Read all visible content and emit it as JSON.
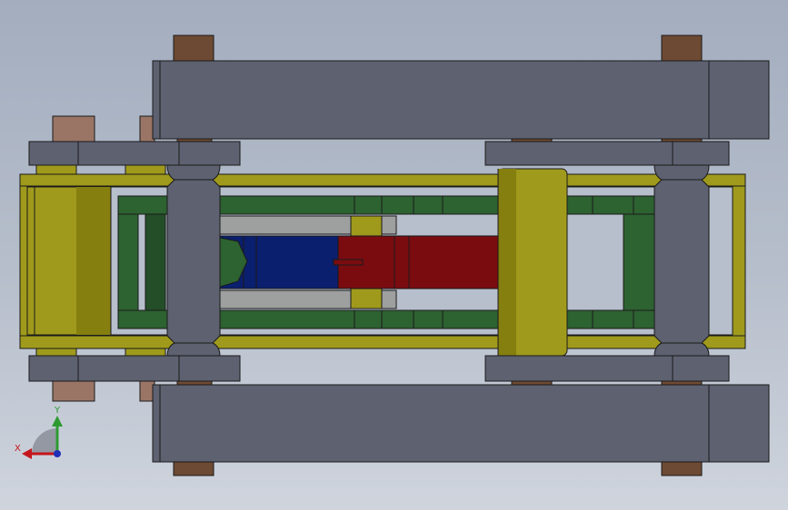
{
  "viewport": {
    "background_top": "#a3adbe",
    "background_bottom": "#cfd4dd"
  },
  "palette": {
    "frame_gray": "#5d6170",
    "frame_gray_dark": "#4f5361",
    "bronze": "#6d4a33",
    "bronze_light": "#9a7566",
    "olive": "#a09a1c",
    "olive_dark": "#857f10",
    "green": "#2d6231",
    "green_dark": "#234e27",
    "light_gray": "#9ea0a0",
    "blue": "#0a1f6e",
    "red": "#7a0c10",
    "outline": "#1a1a1a"
  },
  "triad": {
    "x_label": "X",
    "y_label": "Y",
    "x_color": "#c4161c",
    "y_color": "#2e9a32",
    "z_color": "#1f2fb8"
  }
}
